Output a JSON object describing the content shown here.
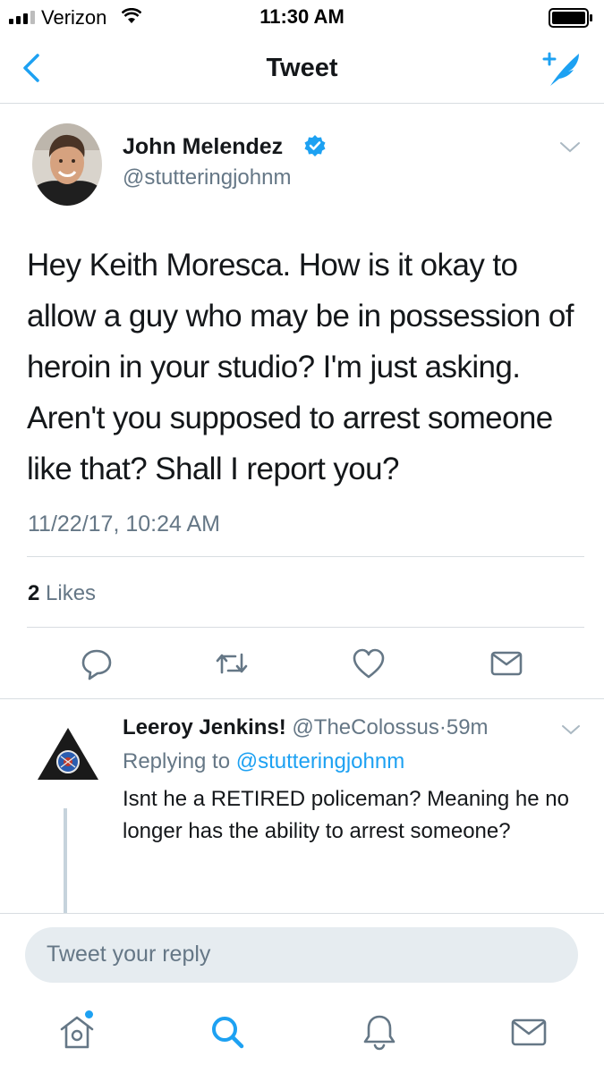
{
  "status_bar": {
    "carrier": "Verizon",
    "time": "11:30 AM",
    "signal_bars_filled": 3,
    "signal_bars_total": 4
  },
  "nav": {
    "title": "Tweet",
    "back_icon": "chevron-left-icon",
    "compose_icon": "compose-tweet-icon"
  },
  "tweet": {
    "author_name": "John Melendez",
    "author_handle": "@stutteringjohnm",
    "verified": true,
    "text": "Hey Keith Moresca. How is it okay to allow a guy who may be in possession of heroin in your studio? I'm just asking. Aren't you supposed to arrest someone like that? Shall I report you?",
    "timestamp": "11/22/17, 10:24 AM",
    "likes_count": "2",
    "likes_label": "Likes"
  },
  "actions": [
    "reply-icon",
    "retweet-icon",
    "like-icon",
    "direct-message-icon"
  ],
  "reply": {
    "author_name": "Leeroy Jenkins!",
    "author_handle": "@TheColossus",
    "separator": "·",
    "age": "59m",
    "replying_prefix": "Replying to",
    "replying_to": "@stutteringjohnm",
    "text": "Isnt he a RETIRED policeman?  Meaning he no longer has the ability to arrest someone?"
  },
  "composer": {
    "placeholder": "Tweet your reply"
  },
  "tab_bar": [
    "home-icon",
    "search-icon",
    "notifications-icon",
    "messages-icon"
  ],
  "colors": {
    "accent": "#1da1f2",
    "secondary_text": "#657786",
    "divider": "#d8dde1",
    "composer_bg": "#e6ecf0"
  }
}
